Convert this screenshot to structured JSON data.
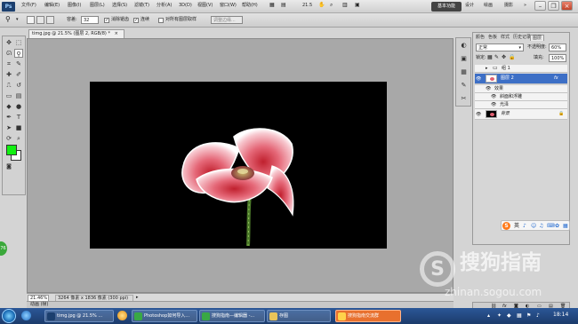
{
  "app": {
    "logo": "Ps"
  },
  "menu": {
    "items": [
      "文件(F)",
      "编辑(E)",
      "图像(I)",
      "图层(L)",
      "选择(S)",
      "滤镜(T)",
      "分析(A)",
      "3D(D)",
      "视图(V)",
      "窗口(W)",
      "帮助(H)"
    ],
    "zoom": "21.5"
  },
  "workspace": {
    "tabs": [
      "基本功能",
      "设计",
      "绘画",
      "摄影"
    ],
    "more": "»"
  },
  "options": {
    "tolerance_label": "容差:",
    "tolerance_value": "32",
    "antialias_label": "消除锯齿",
    "contiguous_label": "连续",
    "all_layers_label": "对所有图层取样",
    "refine_edge_button": "调整边缘..."
  },
  "document": {
    "tab_title": "timg.jpg @ 21.5% (图层 2, RGB/8) *",
    "close_glyph": "×"
  },
  "status": {
    "zoom": "21.46%",
    "doc_info": "3264 像素 x 1836 像素 (300 ppi)"
  },
  "bottom_bar": {
    "label": "动画 (帧)"
  },
  "panels": {
    "tabs": [
      "颜色",
      "色板",
      "样式",
      "历史记录",
      "图层"
    ],
    "blend_mode": "正常",
    "opacity_label": "不透明度:",
    "opacity_value": "60%",
    "lock_label": "锁定:",
    "fill_label": "填充:",
    "fill_value": "100%",
    "layers": [
      {
        "name": "组 1",
        "kind": "group"
      },
      {
        "name": "图层 2",
        "kind": "layer",
        "fx": "fx"
      },
      {
        "name": "效果",
        "kind": "effects"
      },
      {
        "name": "斜面和浮雕",
        "kind": "effect"
      },
      {
        "name": "光泽",
        "kind": "effect"
      },
      {
        "name": "背景",
        "kind": "background"
      }
    ]
  },
  "ime": {
    "logo": "S",
    "lang": "英"
  },
  "watermark": {
    "title": "搜狗指南",
    "url": "zhinan.sogou.com"
  },
  "taskbar": {
    "buttons": [
      "timg.jpg @ 21.5% ...",
      "Photoshop如何导入...",
      "搜狗指南—编辑器 -...",
      "存图",
      "搜狗指南交流群"
    ],
    "clock": "18:14"
  },
  "side": {
    "badge": "76"
  },
  "colors": {
    "foreground": "#13f013",
    "background": "#ffffff",
    "workspace_active": "#444444",
    "taskbar": "#2b5797"
  }
}
